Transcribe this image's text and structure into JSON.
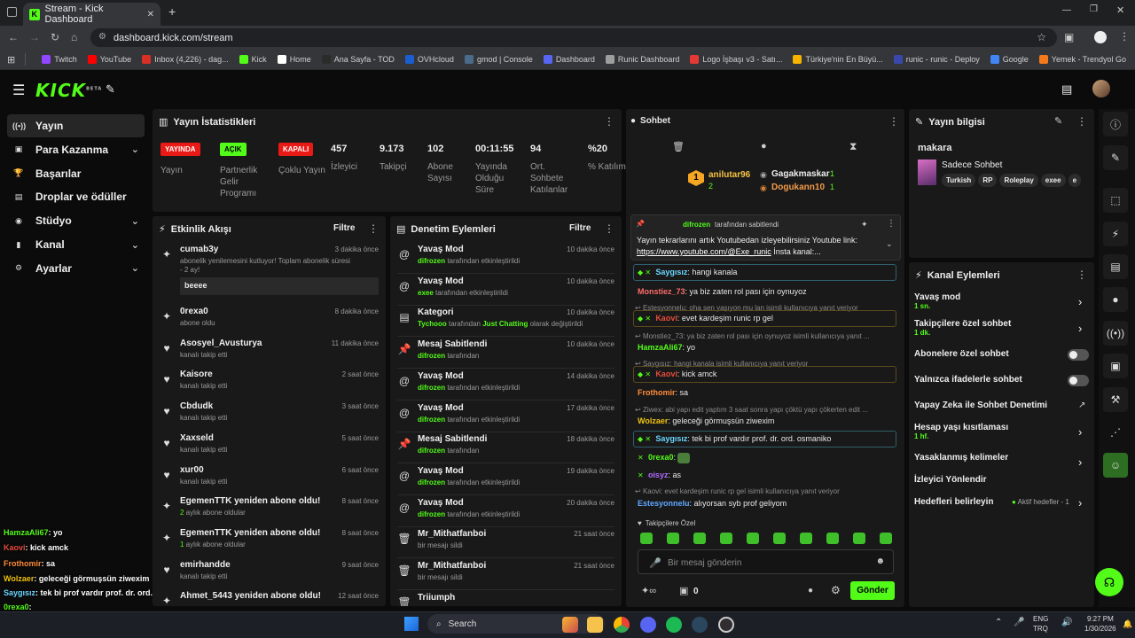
{
  "browser": {
    "tab_title": "Stream - Kick Dashboard",
    "url": "dashboard.kick.com/stream",
    "bookmarks": [
      {
        "label": "Twitch",
        "color": "#9146ff"
      },
      {
        "label": "YouTube",
        "color": "#ff0000"
      },
      {
        "label": "Inbox (4,226) - dag...",
        "color": "#d93025"
      },
      {
        "label": "Kick",
        "color": "#53fc18"
      },
      {
        "label": "Home",
        "color": "#ffffff"
      },
      {
        "label": "Ana Sayfa - TOD",
        "color": "#2b2b2b"
      },
      {
        "label": "OVHcloud",
        "color": "#1a5ecf"
      },
      {
        "label": "gmod | Console",
        "color": "#4a6b8a"
      },
      {
        "label": "Dashboard",
        "color": "#5865f2"
      },
      {
        "label": "Runic Dashboard",
        "color": "#9e9e9e"
      },
      {
        "label": "Logo İşbaşı v3 - Satı...",
        "color": "#e53935"
      },
      {
        "label": "Türkiye'nin En Büyü...",
        "color": "#f4b400"
      },
      {
        "label": "runic - runic - Deploy",
        "color": "#3949ab"
      },
      {
        "label": "Google",
        "color": "#4285f4"
      },
      {
        "label": "Yemek - Trendyol Go",
        "color": "#f27a1a"
      }
    ]
  },
  "kick": {
    "logo": "KICK",
    "beta": "BETA"
  },
  "nav": [
    {
      "label": "Yayın",
      "icon": "broadcast-icon",
      "active": true,
      "chev": false
    },
    {
      "label": "Para Kazanma",
      "icon": "money-icon",
      "chev": true
    },
    {
      "label": "Başarılar",
      "icon": "trophy-icon",
      "chev": false
    },
    {
      "label": "Droplar ve ödüller",
      "icon": "gift-icon",
      "chev": false
    },
    {
      "label": "Stüdyo",
      "icon": "studio-icon",
      "chev": true
    },
    {
      "label": "Kanal",
      "icon": "channel-icon",
      "chev": true
    },
    {
      "label": "Ayarlar",
      "icon": "gear-icon",
      "chev": true
    }
  ],
  "stats": {
    "title": "Yayın İstatistikleri",
    "badges": [
      {
        "badge": "YAYINDA",
        "label": "Yayın",
        "color": "#e91916",
        "text": "#fff"
      },
      {
        "badge": "AÇIK",
        "label": "Partnerlik Gelir Programı",
        "color": "#53fc18",
        "text": "#000"
      },
      {
        "badge": "KAPALI",
        "label": "Çoklu Yayın",
        "color": "#e91916",
        "text": "#fff"
      }
    ],
    "metrics": [
      {
        "value": "457",
        "label": "İzleyici"
      },
      {
        "value": "9.173",
        "label": "Takipçi"
      },
      {
        "value": "102",
        "label": "Abone Sayısı"
      },
      {
        "value": "00:11:55",
        "label": "Yayında Olduğu Süre"
      },
      {
        "value": "94",
        "label": "Ort. Sohbete Katılanlar"
      },
      {
        "value": "%20",
        "label": "% Katılım"
      }
    ]
  },
  "activity": {
    "title": "Etkinlik Akışı",
    "filter": "Filtre",
    "items": [
      {
        "name": "cumab3y",
        "sub": "abonelik yenilemesini kutluyor! Toplam abonelik süresi - 2 ay!",
        "time": "3 dakika önce",
        "msg": "beeee",
        "icon": "sparkle-icon"
      },
      {
        "name": "0rexa0",
        "sub": "abone oldu",
        "time": "8 dakika önce",
        "icon": "star-icon"
      },
      {
        "name": "Asosyel_Avusturya",
        "sub": "kanalı takip etti",
        "time": "11 dakika önce",
        "icon": "heart-icon"
      },
      {
        "name": "Kaisore",
        "sub": "kanalı takip etti",
        "time": "2 saat önce",
        "icon": "heart-icon"
      },
      {
        "name": "Cbdudk",
        "sub": "kanalı takip etti",
        "time": "3 saat önce",
        "icon": "heart-icon"
      },
      {
        "name": "Xaxseld",
        "sub": "kanalı takip etti",
        "time": "5 saat önce",
        "icon": "heart-icon"
      },
      {
        "name": "xur00",
        "sub": "kanalı takip etti",
        "time": "6 saat önce",
        "icon": "heart-icon"
      },
      {
        "name": "EgemenTTK yeniden abone oldu!",
        "sub_g": "2",
        "sub": " aylık abone oldular",
        "time": "8 saat önce",
        "icon": "star-icon"
      },
      {
        "name": "EgemenTTK yeniden abone oldu!",
        "sub_g": "1",
        "sub": " aylık abone oldular",
        "time": "8 saat önce",
        "icon": "star-icon"
      },
      {
        "name": "emirhandde",
        "sub": "kanalı takip etti",
        "time": "9 saat önce",
        "icon": "heart-icon"
      },
      {
        "name": "Ahmet_5443 yeniden abone oldu!",
        "sub": "",
        "time": "12 saat önce",
        "icon": "star-icon"
      }
    ]
  },
  "moderation": {
    "title": "Denetim Eylemleri",
    "filter": "Filtre",
    "items": [
      {
        "name": "Yavaş Mod",
        "user": "difrozen",
        "sub": " tarafından etkinleştirildi",
        "time": "10 dakika önce",
        "icon": "snail-icon"
      },
      {
        "name": "Yavaş Mod",
        "user": "exee",
        "sub": " tarafından etkinleştirildi",
        "time": "10 dakika önce",
        "icon": "snail-icon"
      },
      {
        "name": "Kategori",
        "user": "Tychooo",
        "sub": " tarafından ",
        "extra": "Just Chatting",
        "sub2": " olarak değiştirildi",
        "time": "10 dakika önce",
        "icon": "category-icon"
      },
      {
        "name": "Mesaj Sabitlendi",
        "user": "difrozen",
        "sub": " tarafından",
        "time": "10 dakika önce",
        "icon": "pin-icon"
      },
      {
        "name": "Yavaş Mod",
        "user": "difrozen",
        "sub": " tarafından etkinleştirildi",
        "time": "14 dakika önce",
        "icon": "snail-icon"
      },
      {
        "name": "Yavaş Mod",
        "user": "difrozen",
        "sub": " tarafından etkinleştirildi",
        "time": "17 dakika önce",
        "icon": "snail-icon"
      },
      {
        "name": "Mesaj Sabitlendi",
        "user": "difrozen",
        "sub": " tarafından",
        "time": "18 dakika önce",
        "icon": "pin-icon"
      },
      {
        "name": "Yavaş Mod",
        "user": "difrozen",
        "sub": " tarafından etkinleştirildi",
        "time": "19 dakika önce",
        "icon": "snail-icon"
      },
      {
        "name": "Yavaş Mod",
        "user": "difrozen",
        "sub": " tarafından etkinleştirildi",
        "time": "20 dakika önce",
        "icon": "snail-icon"
      },
      {
        "name": "Mr_Mithatfanboi",
        "user": "",
        "sub": "bir mesajı sildi",
        "time": "21 saat önce",
        "icon": "trash-icon"
      },
      {
        "name": "Mr_Mithatfanboi",
        "user": "",
        "sub": "bir mesajı sildi",
        "time": "21 saat önce",
        "icon": "trash-icon"
      },
      {
        "name": "Triiumph",
        "user": "",
        "sub": "",
        "time": "",
        "icon": "trash-icon"
      }
    ]
  },
  "chat": {
    "title": "Sohbet",
    "leaders": {
      "first": {
        "rank": "1",
        "name": "anilutar96",
        "count": "2"
      },
      "second": {
        "name": "Gagakmaskar",
        "count": "1"
      },
      "third": {
        "name": "Dogukann10",
        "count": "1"
      }
    },
    "pinned": {
      "by": "difrozen",
      "by_suffix": "tarafından sabitlendi",
      "text": "Yayın tekrarlarını artık Youtubedan izleyebilirsiniz Youtube link: ",
      "link": "https://www.youtube.com/@Exe_runic",
      "text2": " İnsta kanal:..."
    },
    "messages": [
      {
        "type": "msg",
        "user": "Saygısız",
        "color": "#6bd6ff",
        "text": "hangi kanala",
        "boxed": true
      },
      {
        "type": "msg",
        "user": "Monstiez_73",
        "color": "#ff6b6b",
        "text": "ya biz zaten rol pası için oynuyoz"
      },
      {
        "type": "reply",
        "text": "Estesyonnelu: oha sen yaşıyon mu lan isimli kullanıcıya yanıt veriyor"
      },
      {
        "type": "msg",
        "user": "Kaovi",
        "color": "#e74c3c",
        "text": "evet kardeşim runic rp gel",
        "boxed": true
      },
      {
        "type": "reply",
        "text": "Monstiez_73: ya biz zaten rol pası için oynuyoz isimli kullanıcıya yanıt ..."
      },
      {
        "type": "msg",
        "user": "HamzaAli67",
        "color": "#53fc18",
        "text": "yo"
      },
      {
        "type": "reply",
        "text": "Saygısız: hangi kanala isimli kullanıcıya yanıt veriyor"
      },
      {
        "type": "msg",
        "user": "Kaovi",
        "color": "#e74c3c",
        "text": "kick amck",
        "boxed": true
      },
      {
        "type": "msg",
        "user": "Frothomir",
        "color": "#ff8c3a",
        "text": "sa"
      },
      {
        "type": "reply",
        "text": "Ziwex: abi yapı edit yaptım 3 saat sonra yapı çöktü yapı çökerten edit ..."
      },
      {
        "type": "msg",
        "user": "Wolzaer",
        "color": "#f1c40f",
        "text": "geleceği görmuşsün ziwexim"
      },
      {
        "type": "msg",
        "user": "Saygısız",
        "color": "#6bd6ff",
        "text": "tek bi prof vardır prof. dr. ord. osmaniko",
        "boxed": true
      },
      {
        "type": "msg",
        "user": "0rexa0",
        "color": "#53fc18",
        "text": ""
      },
      {
        "type": "msg",
        "user": "oisyz",
        "color": "#b36bff",
        "text": "as"
      },
      {
        "type": "reply",
        "text": "Kaovi: evet kardeşim runic rp gel isimli kullanıcıya yanıt veriyor"
      },
      {
        "type": "msg",
        "user": "Estesyonnelu",
        "color": "#5fa8ff",
        "text": "alıyorsan syb prof geliyom"
      }
    ],
    "emote_label": "Takipçilere Özel",
    "input_placeholder": "Bir mesaj gönderin",
    "points": "0",
    "send": "Gönder"
  },
  "stream_info": {
    "title": "Yayın bilgisi",
    "stream_title": "makara",
    "category": "Sadece Sohbet",
    "tags": [
      "Turkish",
      "RP",
      "Roleplay",
      "exee",
      "e"
    ]
  },
  "channel_actions": {
    "title": "Kanal Eylemleri",
    "items": [
      {
        "label": "Yavaş mod",
        "sub": "1 sn.",
        "control": "chevron"
      },
      {
        "label": "Takipçilere özel sohbet",
        "sub": "1 dk.",
        "control": "chevron"
      },
      {
        "label": "Abonelere özel sohbet",
        "sub": "",
        "control": "toggle"
      },
      {
        "label": "Yalnızca ifadelerle sohbet",
        "sub": "",
        "control": "toggle"
      },
      {
        "label": "Yapay Zeka ile Sohbet Denetimi",
        "sub": "",
        "control": "external"
      },
      {
        "label": "Hesap yaşı kısıtlaması",
        "sub": "1 hf.",
        "control": "chevron"
      },
      {
        "label": "Yasaklanmış kelimeler",
        "sub": "",
        "control": "chevron"
      },
      {
        "label": "İzleyici Yönlendir",
        "sub": "",
        "control": "none"
      },
      {
        "label": "Hedefleri belirleyin",
        "sub": "",
        "control": "goals",
        "goal_text": "Aktif hedefler - 1"
      }
    ]
  },
  "overlay_chat": [
    {
      "user": "HamzaAli67",
      "color": "#53fc18",
      "text": ": yo"
    },
    {
      "user": "Kaovi",
      "color": "#e74c3c",
      "text": ": kick amck"
    },
    {
      "user": "Frothomir",
      "color": "#ff8c3a",
      "text": ": sa"
    },
    {
      "user": "Wolzaer",
      "color": "#f1c40f",
      "text": ": geleceği görmuşsün ziwexim"
    },
    {
      "user": "Saygısız",
      "color": "#6bd6ff",
      "text": ": tek bi prof vardır prof. dr. ord. osmaniko"
    },
    {
      "user": "0rexa0",
      "color": "#53fc18",
      "text": ":"
    },
    {
      "user": "oisyz",
      "color": "#b36bff",
      "text": ": as"
    },
    {
      "user": "Estesyonnelu",
      "color": "#5fa8ff",
      "text": ": alıyorsan syb prof geliyom"
    }
  ],
  "taskbar": {
    "search": "Search",
    "lang1": "ENG",
    "lang2": "TRQ",
    "time": "9:27 PM",
    "date": "1/30/2026"
  }
}
